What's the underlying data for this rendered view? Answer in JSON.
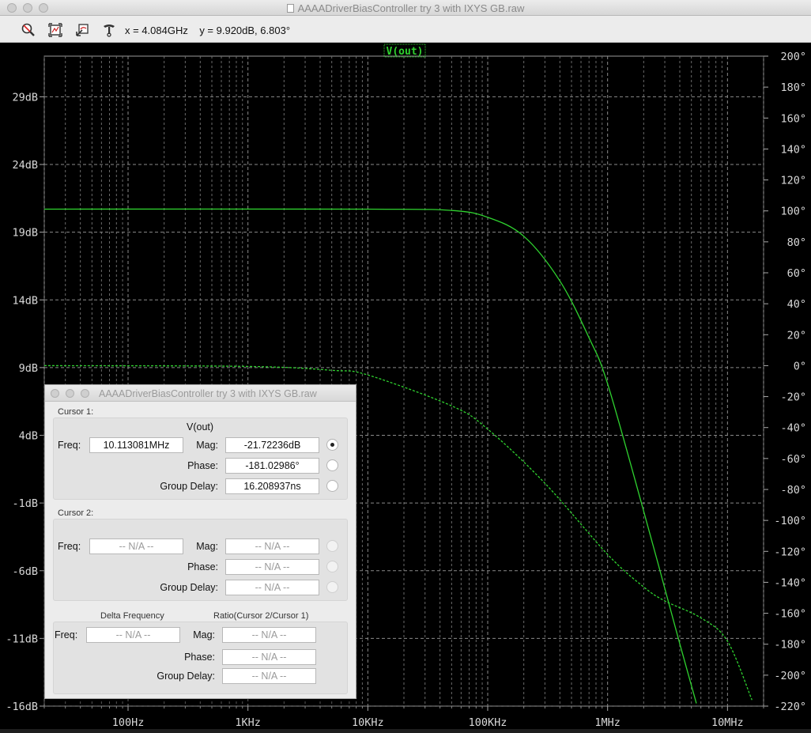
{
  "window": {
    "title": "AAAADriverBiasController try 3 with IXYS GB.raw"
  },
  "toolbar": {
    "buttons": [
      "zoom-icon",
      "autorange-icon",
      "undo-zoom-icon",
      "probe-icon"
    ],
    "x_readout": "x = 4.084GHz",
    "y_readout": "y = 9.920dB, 6.803°"
  },
  "chart_data": {
    "type": "line",
    "title": "V(out)",
    "xscale": "log",
    "xlim": [
      20,
      20000000
    ],
    "ylim_left": [
      -16,
      32
    ],
    "ylim_right": [
      -220,
      200
    ],
    "x_ticks": [
      "100Hz",
      "1KHz",
      "10KHz",
      "100KHz",
      "1MHz",
      "10MHz"
    ],
    "y_ticks_left": [
      "29dB",
      "24dB",
      "19dB",
      "14dB",
      "9dB",
      "4dB",
      "-1dB",
      "-6dB",
      "-11dB",
      "-16dB"
    ],
    "y_ticks_right": [
      "200°",
      "180°",
      "160°",
      "140°",
      "120°",
      "100°",
      "80°",
      "60°",
      "40°",
      "20°",
      "0°",
      "-20°",
      "-40°",
      "-60°",
      "-80°",
      "-100°",
      "-120°",
      "-140°",
      "-160°",
      "-180°",
      "-200°",
      "-220°"
    ],
    "grid": true,
    "series": [
      {
        "name": "V(out)",
        "style": "solid",
        "axis": "left",
        "color": "#2fd22f",
        "x": [
          20,
          10000,
          50000,
          100000,
          200000,
          400000,
          700000,
          1000000,
          2000000,
          4000000,
          5500000
        ],
        "y": [
          20.7,
          20.7,
          20.6,
          20.1,
          18.7,
          15.4,
          11.2,
          7.8,
          -1.6,
          -11.4,
          -15.8
        ]
      },
      {
        "name": "V(out) phase",
        "style": "dashed",
        "axis": "right",
        "color": "#2fd22f",
        "x": [
          20,
          1000,
          5000,
          10000,
          50000,
          100000,
          300000,
          1000000,
          2000000,
          3000000,
          6000000,
          10000000,
          16000000
        ],
        "y": [
          0,
          -0.5,
          -3,
          -6,
          -26,
          -41,
          -76,
          -122,
          -143,
          -152,
          -163,
          -178,
          -216
        ]
      }
    ]
  },
  "cursor_dialog": {
    "title": "AAAADriverBiasController try 3 with IXYS GB.raw",
    "cursor1": {
      "label": "Cursor 1:",
      "trace": "V(out)",
      "freq_label": "Freq:",
      "freq": "10.113081MHz",
      "mag_label": "Mag:",
      "mag": "-21.72236dB",
      "phase_label": "Phase:",
      "phase": "-181.02986°",
      "gd_label": "Group Delay:",
      "gd": "16.208937ns"
    },
    "cursor2": {
      "label": "Cursor 2:",
      "freq_label": "Freq:",
      "freq": "-- N/A --",
      "mag_label": "Mag:",
      "mag": "-- N/A --",
      "phase_label": "Phase:",
      "phase": "-- N/A --",
      "gd_label": "Group Delay:",
      "gd": "-- N/A --"
    },
    "delta": {
      "freq_header": "Delta Frequency",
      "ratio_header": "Ratio(Cursor 2/Cursor 1)",
      "freq_label": "Freq:",
      "freq": "-- N/A --",
      "mag_label": "Mag:",
      "mag": "-- N/A --",
      "phase_label": "Phase:",
      "phase": "-- N/A --",
      "gd_label": "Group Delay:",
      "gd": "-- N/A --"
    }
  }
}
